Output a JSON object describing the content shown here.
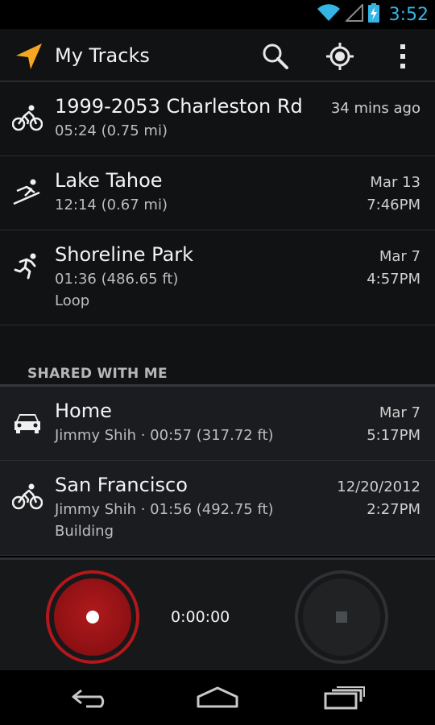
{
  "status_bar": {
    "time": "3:52",
    "icons": [
      "wifi-icon",
      "signal-icon",
      "battery-charging-icon"
    ],
    "accent_color": "#33b5e5"
  },
  "action_bar": {
    "title": "My Tracks",
    "app_icon": "navigation-arrow-icon",
    "actions": [
      "search-icon",
      "my-location-icon",
      "overflow-menu-icon"
    ],
    "brand_color": "#f5a623"
  },
  "tracks": [
    {
      "icon": "biking-icon",
      "name": "1999-2053 Charleston Rd",
      "detail": "05:24 (0.75 mi)",
      "extra": "",
      "date": "34 mins ago",
      "time": ""
    },
    {
      "icon": "skiing-icon",
      "name": "Lake Tahoe",
      "detail": "12:14 (0.67 mi)",
      "extra": "",
      "date": "Mar 13",
      "time": "7:46PM"
    },
    {
      "icon": "running-icon",
      "name": "Shoreline Park",
      "detail": "01:36 (486.65 ft)",
      "extra": "Loop",
      "date": "Mar 7",
      "time": "4:57PM"
    }
  ],
  "shared_section": {
    "label": "SHARED WITH ME",
    "tracks": [
      {
        "icon": "car-icon",
        "name": "Home",
        "detail": "Jimmy Shih · 00:57 (317.72 ft)",
        "extra": "",
        "date": "Mar 7",
        "time": "5:17PM"
      },
      {
        "icon": "biking-icon",
        "name": "San Francisco",
        "detail": "Jimmy Shih · 01:56 (492.75 ft)",
        "extra": "Building",
        "date": "12/20/2012",
        "time": "2:27PM"
      }
    ]
  },
  "controls": {
    "timer": "0:00:00",
    "record_color": "#b3171b"
  },
  "nav_bar": [
    "back-icon",
    "home-icon",
    "recent-apps-icon"
  ]
}
